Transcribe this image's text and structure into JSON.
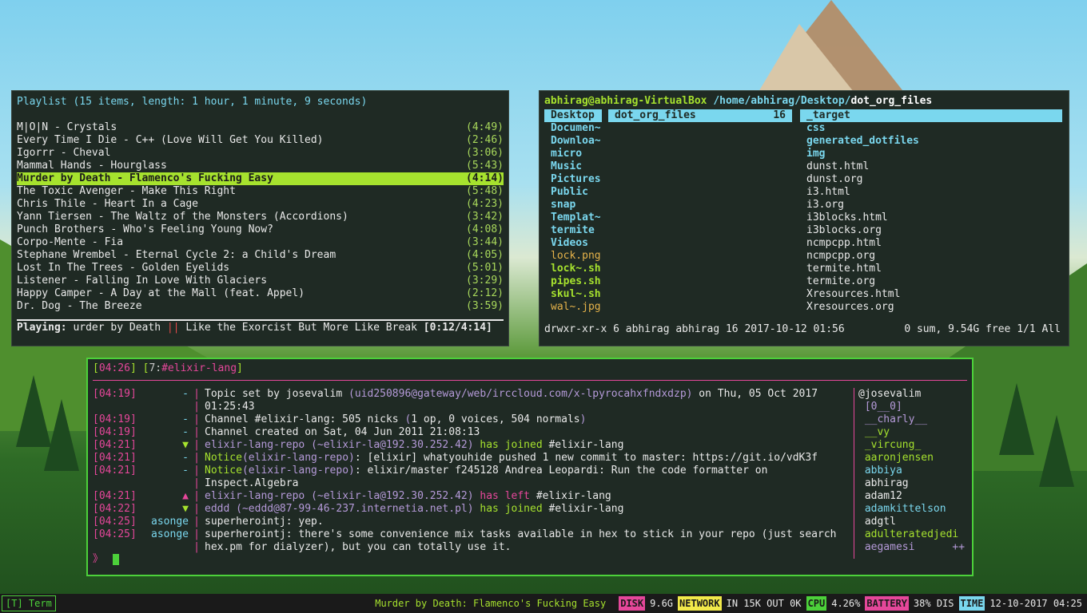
{
  "playlist": {
    "title": "Playlist (15 items, length: 1 hour, 1 minute, 9 seconds)",
    "items": [
      {
        "name": "M|O|N - Crystals",
        "dur": "(4:49)"
      },
      {
        "name": "Every Time I Die - C++ (Love Will Get You Killed)",
        "dur": "(2:46)"
      },
      {
        "name": "Igorrr - Cheval",
        "dur": "(3:06)"
      },
      {
        "name": "Mammal Hands - Hourglass",
        "dur": "(5:43)"
      },
      {
        "name": "Murder by Death - Flamenco's Fucking Easy",
        "dur": "(4:14)"
      },
      {
        "name": "The Toxic Avenger - Make This Right",
        "dur": "(5:48)"
      },
      {
        "name": "Chris Thile - Heart In a Cage",
        "dur": "(4:23)"
      },
      {
        "name": "Yann Tiersen - The Waltz of the Monsters (Accordions)",
        "dur": "(3:42)"
      },
      {
        "name": "Punch Brothers - Who's Feeling Young Now?",
        "dur": "(4:08)"
      },
      {
        "name": "Corpo-Mente - Fia",
        "dur": "(3:44)"
      },
      {
        "name": "Stephane Wrembel - Eternal Cycle 2: a Child's Dream",
        "dur": "(4:05)"
      },
      {
        "name": "Lost In The Trees - Golden Eyelids",
        "dur": "(5:01)"
      },
      {
        "name": "Listener - Falling In Love With Glaciers",
        "dur": "(3:29)"
      },
      {
        "name": "Happy Camper - A Day at the Mall (feat. Appel)",
        "dur": "(2:12)"
      },
      {
        "name": "Dr. Dog - The Breeze",
        "dur": "(3:59)"
      }
    ],
    "status_label": "Playing:",
    "status_text1": " urder by Death ",
    "status_pipe": "||",
    "status_text2": " Like the Exorcist But More Like Break ",
    "status_time": "[0:12/4:14]"
  },
  "ranger": {
    "user": "abhirag@abhirag-VirtualBox",
    "path": " /home/abhirag/Desktop/",
    "cur": "dot_org_files",
    "col1": [
      {
        "t": "Desktop",
        "c": "hl"
      },
      {
        "t": "Documen~",
        "c": "dir"
      },
      {
        "t": "Downloa~",
        "c": "dir"
      },
      {
        "t": "micro",
        "c": "dir"
      },
      {
        "t": "Music",
        "c": "dir"
      },
      {
        "t": "Pictures",
        "c": "dir"
      },
      {
        "t": "Public",
        "c": "dir"
      },
      {
        "t": "snap",
        "c": "dir"
      },
      {
        "t": "Templat~",
        "c": "dir"
      },
      {
        "t": "termite",
        "c": "dir"
      },
      {
        "t": "Videos",
        "c": "dir"
      },
      {
        "t": "lock.png",
        "c": "img"
      },
      {
        "t": "lock~.sh",
        "c": "exe"
      },
      {
        "t": "pipes.sh",
        "c": "exe"
      },
      {
        "t": "skul~.sh",
        "c": "exe"
      },
      {
        "t": "wal~.jpg",
        "c": "img"
      }
    ],
    "col2_name": "dot_org_files",
    "col2_count": "16",
    "col3": [
      {
        "t": "_target",
        "c": "hl"
      },
      {
        "t": "css",
        "c": "dir"
      },
      {
        "t": "generated_dotfiles",
        "c": "dir"
      },
      {
        "t": "img",
        "c": "dir"
      },
      {
        "t": "dunst.html",
        "c": "file"
      },
      {
        "t": "dunst.org",
        "c": "file"
      },
      {
        "t": "i3.html",
        "c": "file"
      },
      {
        "t": "i3.org",
        "c": "file"
      },
      {
        "t": "i3blocks.html",
        "c": "file"
      },
      {
        "t": "i3blocks.org",
        "c": "file"
      },
      {
        "t": "ncmpcpp.html",
        "c": "file"
      },
      {
        "t": "ncmpcpp.org",
        "c": "file"
      },
      {
        "t": "termite.html",
        "c": "file"
      },
      {
        "t": "termite.org",
        "c": "file"
      },
      {
        "t": "Xresources.html",
        "c": "file"
      },
      {
        "t": "Xresources.org",
        "c": "file"
      }
    ],
    "footer_left": "drwxr-xr-x 6 abhirag abhirag 16 2017-10-12 01:56",
    "footer_right": "0 sum, 9.54G free  1/1  All"
  },
  "irc": {
    "time": "04:26",
    "win_num": "7",
    "channel": "#elixir-lang",
    "messages": [
      {
        "ts": "[04:19]",
        "nick": "-",
        "parts": [
          [
            "txt",
            "Topic set by josevalim "
          ],
          [
            "gray",
            "(uid250896@gateway/web/irccloud.com/x-lpyrocahxfndxdzp)"
          ],
          [
            "txt",
            " on Thu, 05 Oct 2017"
          ]
        ]
      },
      {
        "ts": "",
        "nick": "",
        "parts": [
          [
            "txt",
            "01:25:43"
          ]
        ]
      },
      {
        "ts": "[04:19]",
        "nick": "-",
        "parts": [
          [
            "txt",
            "Channel #elixir-lang: 505 nicks "
          ],
          [
            "gray",
            "("
          ],
          [
            "txt",
            "1 op, 0 voices, 504 normals"
          ],
          [
            "gray",
            ")"
          ]
        ]
      },
      {
        "ts": "[04:19]",
        "nick": "-",
        "parts": [
          [
            "txt",
            "Channel created on Sat, 04 Jun 2011 21:08:13"
          ]
        ]
      },
      {
        "ts": "[04:21]",
        "nick": "▼",
        "nc": "join",
        "parts": [
          [
            "gray",
            "elixir-lang-repo "
          ],
          [
            "gray",
            "(~elixir-la@192.30.252.42)"
          ],
          [
            "join",
            " has joined "
          ],
          [
            "chan",
            "#elixir-lang"
          ]
        ]
      },
      {
        "ts": "[04:21]",
        "nick": "-",
        "parts": [
          [
            "notice",
            "Notice"
          ],
          [
            "gray",
            "(elixir-lang-repo)"
          ],
          [
            "txt",
            ": [elixir] whatyouhide pushed 1 new commit to master: https://git.io/vdK3f"
          ]
        ]
      },
      {
        "ts": "[04:21]",
        "nick": "-",
        "parts": [
          [
            "notice",
            "Notice"
          ],
          [
            "gray",
            "(elixir-lang-repo)"
          ],
          [
            "txt",
            ": elixir/master f245128 Andrea Leopardi: Run the code formatter on"
          ]
        ]
      },
      {
        "ts": "",
        "nick": "",
        "parts": [
          [
            "txt",
            "Inspect.Algebra"
          ]
        ]
      },
      {
        "ts": "[04:21]",
        "nick": "▲",
        "nc": "part",
        "parts": [
          [
            "gray",
            "elixir-lang-repo "
          ],
          [
            "gray",
            "(~elixir-la@192.30.252.42)"
          ],
          [
            "part",
            " has left "
          ],
          [
            "chan",
            "#elixir-lang"
          ]
        ]
      },
      {
        "ts": "[04:22]",
        "nick": "▼",
        "nc": "join",
        "parts": [
          [
            "gray",
            "eddd "
          ],
          [
            "gray",
            "(~eddd@87-99-46-237.internetia.net.pl)"
          ],
          [
            "join",
            " has joined "
          ],
          [
            "chan",
            "#elixir-lang"
          ]
        ]
      },
      {
        "ts": "[04:25]",
        "nick": "asonge",
        "parts": [
          [
            "txt",
            "superherointj: yep."
          ]
        ]
      },
      {
        "ts": "[04:25]",
        "nick": "asonge",
        "parts": [
          [
            "txt",
            "superherointj: there's some convenience mix tasks available in hex to stick in your repo (just search"
          ]
        ]
      },
      {
        "ts": "",
        "nick": "",
        "parts": [
          [
            "txt",
            "hex.pm for dialyzer), but you can totally use it."
          ]
        ]
      }
    ],
    "nicks": [
      {
        "t": "@josevalim",
        "c": "#e9e9e9"
      },
      {
        "t": " [0__0]",
        "c": "#b59ad9"
      },
      {
        "t": " __charly__",
        "c": "#b59ad9"
      },
      {
        "t": " __vy",
        "c": "#a6e22e"
      },
      {
        "t": " _vircung_",
        "c": "#a6e22e"
      },
      {
        "t": " aaronjensen",
        "c": "#a6e22e"
      },
      {
        "t": " abbiya",
        "c": "#7ad7ee"
      },
      {
        "t": " abhirag",
        "c": "#e9e9e9"
      },
      {
        "t": " adam12",
        "c": "#e9e9e9"
      },
      {
        "t": " adamkittelson",
        "c": "#7ad7ee"
      },
      {
        "t": " adgtl",
        "c": "#e9e9e9"
      },
      {
        "t": " adulteratedjedi",
        "c": "#a6e22e"
      },
      {
        "t": " aegamesi      ++",
        "c": "#b59ad9"
      }
    ],
    "prompt": "》"
  },
  "bar": {
    "workspace": "[T] Term",
    "song": "Murder by Death: Flamenco's Fucking Easy",
    "disk_label": "DISK",
    "disk_val": "9.6G",
    "net_label": "NETWORK",
    "net_val": "IN 15K OUT 0K",
    "cpu_label": "CPU",
    "cpu_val": "4.26%",
    "bat_label": "BATTERY",
    "bat_val": "38% DIS",
    "time_label": "TIME",
    "time_val": "12-10-2017 04:25",
    "colors": {
      "disk": "#e5479a",
      "net": "#f2e94a",
      "cpu": "#4cd13a",
      "bat": "#e5479a",
      "time": "#7ad7ee"
    }
  }
}
